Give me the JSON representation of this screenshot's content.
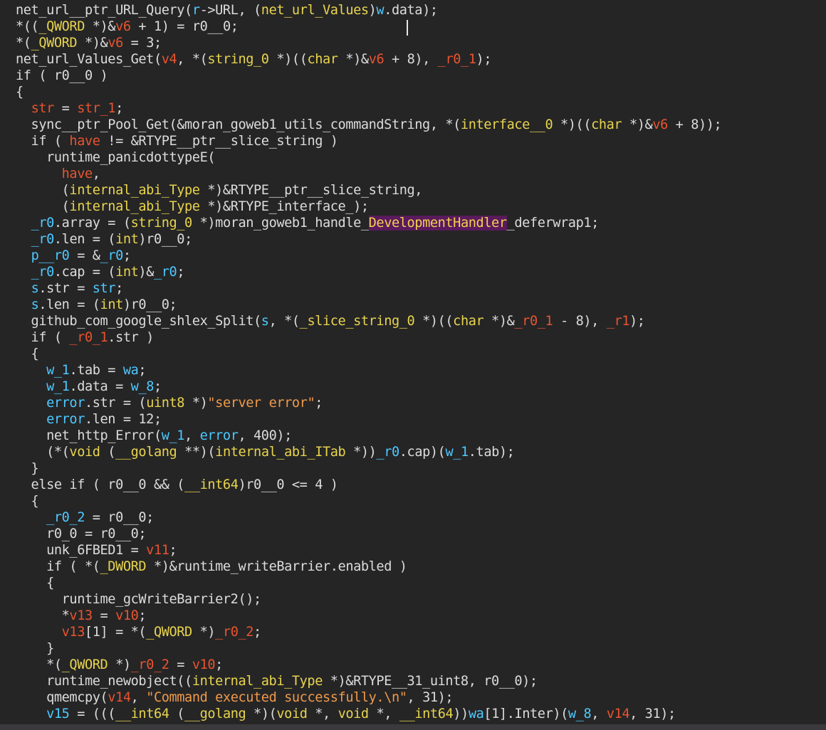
{
  "editor": {
    "lines": [
      [
        [
          "p",
          "net_url__ptr_URL_Query("
        ],
        [
          "v",
          "r"
        ],
        [
          "p",
          "->URL, ("
        ],
        [
          "t",
          "net_url_Values"
        ],
        [
          "p",
          ")"
        ],
        [
          "v",
          "w"
        ],
        [
          "p",
          ".data);"
        ]
      ],
      [
        [
          "p",
          "*(("
        ],
        [
          "t",
          "_QWORD"
        ],
        [
          "p",
          " *)&"
        ],
        [
          "a",
          "v6"
        ],
        [
          "p",
          " + 1) = r0__0;"
        ]
      ],
      [
        [
          "p",
          "*("
        ],
        [
          "t",
          "_QWORD"
        ],
        [
          "p",
          " *)&"
        ],
        [
          "a",
          "v6"
        ],
        [
          "p",
          " = 3;"
        ]
      ],
      [
        [
          "p",
          "net_url_Values_Get("
        ],
        [
          "a",
          "v4"
        ],
        [
          "p",
          ", *("
        ],
        [
          "t",
          "string_0"
        ],
        [
          "p",
          " *)(("
        ],
        [
          "t",
          "char"
        ],
        [
          "p",
          " *)&"
        ],
        [
          "a",
          "v6"
        ],
        [
          "p",
          " + 8), "
        ],
        [
          "a",
          "_r0_1"
        ],
        [
          "p",
          ");"
        ]
      ],
      [
        [
          "p",
          "if ( r0__0 )"
        ]
      ],
      [
        [
          "p",
          "{"
        ]
      ],
      [
        [
          "p",
          "  "
        ],
        [
          "a",
          "str"
        ],
        [
          "p",
          " = "
        ],
        [
          "a",
          "str_1"
        ],
        [
          "p",
          ";"
        ]
      ],
      [
        [
          "p",
          "  sync__ptr_Pool_Get(&moran_goweb1_utils_commandString, *("
        ],
        [
          "t",
          "interface__0"
        ],
        [
          "p",
          " *)(("
        ],
        [
          "t",
          "char"
        ],
        [
          "p",
          " *)&"
        ],
        [
          "a",
          "v6"
        ],
        [
          "p",
          " + 8));"
        ]
      ],
      [
        [
          "p",
          "  if ( "
        ],
        [
          "a",
          "have"
        ],
        [
          "p",
          " != &RTYPE__ptr__slice_string )"
        ]
      ],
      [
        [
          "p",
          "    runtime_panicdottypeE("
        ]
      ],
      [
        [
          "p",
          "      "
        ],
        [
          "a",
          "have"
        ],
        [
          "p",
          ","
        ]
      ],
      [
        [
          "p",
          "      ("
        ],
        [
          "t",
          "internal_abi_Type"
        ],
        [
          "p",
          " *)&RTYPE__ptr__slice_string,"
        ]
      ],
      [
        [
          "p",
          "      ("
        ],
        [
          "t",
          "internal_abi_Type"
        ],
        [
          "p",
          " *)&RTYPE_interface_);"
        ]
      ],
      [
        [
          "p",
          "  "
        ],
        [
          "v",
          "_r0"
        ],
        [
          "p",
          ".array = ("
        ],
        [
          "t",
          "string_0"
        ],
        [
          "p",
          " *)moran_goweb1_handle_"
        ],
        [
          "h",
          "DevelopmentHandler"
        ],
        [
          "p",
          "_deferwrap1;"
        ]
      ],
      [
        [
          "p",
          "  "
        ],
        [
          "v",
          "_r0"
        ],
        [
          "p",
          ".len = ("
        ],
        [
          "t",
          "int"
        ],
        [
          "p",
          ")r0__0;"
        ]
      ],
      [
        [
          "p",
          "  "
        ],
        [
          "v",
          "p__r0"
        ],
        [
          "p",
          " = &"
        ],
        [
          "v",
          "_r0"
        ],
        [
          "p",
          ";"
        ]
      ],
      [
        [
          "p",
          "  "
        ],
        [
          "v",
          "_r0"
        ],
        [
          "p",
          ".cap = ("
        ],
        [
          "t",
          "int"
        ],
        [
          "p",
          ")&"
        ],
        [
          "v",
          "_r0"
        ],
        [
          "p",
          ";"
        ]
      ],
      [
        [
          "p",
          "  "
        ],
        [
          "v",
          "s"
        ],
        [
          "p",
          ".str = "
        ],
        [
          "v",
          "str"
        ],
        [
          "p",
          ";"
        ]
      ],
      [
        [
          "p",
          "  "
        ],
        [
          "v",
          "s"
        ],
        [
          "p",
          ".len = ("
        ],
        [
          "t",
          "int"
        ],
        [
          "p",
          ")r0__0;"
        ]
      ],
      [
        [
          "p",
          "  github_com_google_shlex_Split("
        ],
        [
          "v",
          "s"
        ],
        [
          "p",
          ", *("
        ],
        [
          "t",
          "_slice_string_0"
        ],
        [
          "p",
          " *)(("
        ],
        [
          "t",
          "char"
        ],
        [
          "p",
          " *)&"
        ],
        [
          "a",
          "_r0_1"
        ],
        [
          "p",
          " - 8), "
        ],
        [
          "a",
          "_r1"
        ],
        [
          "p",
          ");"
        ]
      ],
      [
        [
          "p",
          "  if ( "
        ],
        [
          "a",
          "_r0_1"
        ],
        [
          "p",
          ".str )"
        ]
      ],
      [
        [
          "p",
          "  {"
        ]
      ],
      [
        [
          "p",
          "    "
        ],
        [
          "v",
          "w_1"
        ],
        [
          "p",
          ".tab = "
        ],
        [
          "v",
          "wa"
        ],
        [
          "p",
          ";"
        ]
      ],
      [
        [
          "p",
          "    "
        ],
        [
          "v",
          "w_1"
        ],
        [
          "p",
          ".data = "
        ],
        [
          "v",
          "w_8"
        ],
        [
          "p",
          ";"
        ]
      ],
      [
        [
          "p",
          "    "
        ],
        [
          "v",
          "error"
        ],
        [
          "p",
          ".str = ("
        ],
        [
          "t",
          "uint8"
        ],
        [
          "p",
          " *)"
        ],
        [
          "s",
          "\"server error\""
        ],
        [
          "p",
          ";"
        ]
      ],
      [
        [
          "p",
          "    "
        ],
        [
          "v",
          "error"
        ],
        [
          "p",
          ".len = 12;"
        ]
      ],
      [
        [
          "p",
          "    net_http_Error("
        ],
        [
          "v",
          "w_1"
        ],
        [
          "p",
          ", "
        ],
        [
          "v",
          "error"
        ],
        [
          "p",
          ", 400);"
        ]
      ],
      [
        [
          "p",
          "    (*("
        ],
        [
          "t",
          "void"
        ],
        [
          "p",
          " ("
        ],
        [
          "t",
          "__golang"
        ],
        [
          "p",
          " **)("
        ],
        [
          "t",
          "internal_abi_ITab"
        ],
        [
          "p",
          " *))"
        ],
        [
          "v",
          "_r0"
        ],
        [
          "p",
          ".cap)("
        ],
        [
          "v",
          "w_1"
        ],
        [
          "p",
          ".tab);"
        ]
      ],
      [
        [
          "p",
          "  }"
        ]
      ],
      [
        [
          "p",
          "  else if ( r0__0 && ("
        ],
        [
          "t",
          "__int64"
        ],
        [
          "p",
          ")r0__0 <= 4 )"
        ]
      ],
      [
        [
          "p",
          "  {"
        ]
      ],
      [
        [
          "p",
          "    "
        ],
        [
          "v",
          "_r0_2"
        ],
        [
          "p",
          " = r0__0;"
        ]
      ],
      [
        [
          "p",
          "    r0_0 = r0__0;"
        ]
      ],
      [
        [
          "p",
          "    unk_6FBED1 = "
        ],
        [
          "a",
          "v11"
        ],
        [
          "p",
          ";"
        ]
      ],
      [
        [
          "p",
          "    if ( *("
        ],
        [
          "t",
          "_DWORD"
        ],
        [
          "p",
          " *)&runtime_writeBarrier.enabled )"
        ]
      ],
      [
        [
          "p",
          "    {"
        ]
      ],
      [
        [
          "p",
          "      runtime_gcWriteBarrier2();"
        ]
      ],
      [
        [
          "p",
          "      *"
        ],
        [
          "a",
          "v13"
        ],
        [
          "p",
          " = "
        ],
        [
          "a",
          "v10"
        ],
        [
          "p",
          ";"
        ]
      ],
      [
        [
          "p",
          "      "
        ],
        [
          "a",
          "v13"
        ],
        [
          "p",
          "[1] = *("
        ],
        [
          "t",
          "_QWORD"
        ],
        [
          "p",
          " *)"
        ],
        [
          "a",
          "_r0_2"
        ],
        [
          "p",
          ";"
        ]
      ],
      [
        [
          "p",
          "    }"
        ]
      ],
      [
        [
          "p",
          "    *("
        ],
        [
          "t",
          "_QWORD"
        ],
        [
          "p",
          " *)"
        ],
        [
          "a",
          "_r0_2"
        ],
        [
          "p",
          " = "
        ],
        [
          "a",
          "v10"
        ],
        [
          "p",
          ";"
        ]
      ],
      [
        [
          "p",
          "    runtime_newobject(("
        ],
        [
          "t",
          "internal_abi_Type"
        ],
        [
          "p",
          " *)&RTYPE__31_uint8, r0__0);"
        ]
      ],
      [
        [
          "p",
          "    qmemcpy("
        ],
        [
          "a",
          "v14"
        ],
        [
          "p",
          ", "
        ],
        [
          "s",
          "\"Command executed successfully.\\n\""
        ],
        [
          "p",
          ", 31);"
        ]
      ],
      [
        [
          "p",
          "    "
        ],
        [
          "v",
          "v15"
        ],
        [
          "p",
          " = ((("
        ],
        [
          "t",
          "__int64"
        ],
        [
          "p",
          " ("
        ],
        [
          "t",
          "__golang"
        ],
        [
          "p",
          " *)("
        ],
        [
          "t",
          "void"
        ],
        [
          "p",
          " *, "
        ],
        [
          "t",
          "void"
        ],
        [
          "p",
          " *, "
        ],
        [
          "t",
          "__int64"
        ],
        [
          "p",
          "))"
        ],
        [
          "v",
          "wa"
        ],
        [
          "p",
          "[1].Inter)("
        ],
        [
          "v",
          "w_8"
        ],
        [
          "p",
          ", "
        ],
        [
          "a",
          "v14"
        ],
        [
          "p",
          ", 31);"
        ]
      ]
    ]
  },
  "colors": {
    "background": "#252526",
    "plain": "#dcdcdc",
    "variable": "#4ec9ff",
    "type": "#e8d44d",
    "argument": "#e8542e",
    "string": "#f09a4a",
    "highlight_bg": "#5a1a5c"
  }
}
